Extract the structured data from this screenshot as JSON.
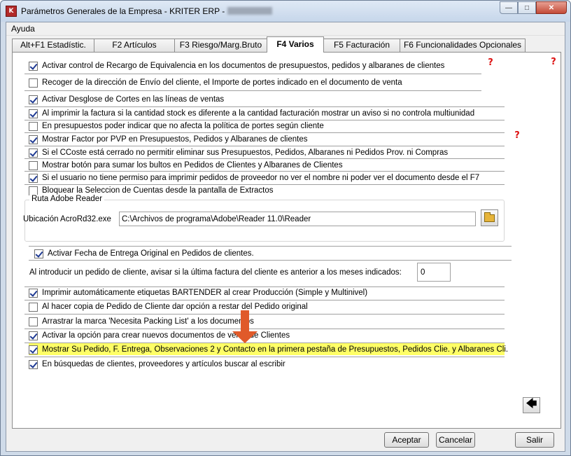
{
  "window": {
    "title": "Parámetros Generales de la Empresa - KRITER ERP -",
    "icon": "app-icon",
    "controls": [
      "minimize-icon",
      "maximize-icon",
      "close-icon"
    ]
  },
  "menu": {
    "items": [
      "Ayuda"
    ]
  },
  "tabs": [
    {
      "label": "Alt+F1 Estadístic.",
      "active": false
    },
    {
      "label": "F2 Artículos",
      "active": false
    },
    {
      "label": "F3 Riesgo/Marg.Bruto",
      "active": false
    },
    {
      "label": "F4 Varios",
      "active": true
    },
    {
      "label": "F5 Facturación",
      "active": false
    },
    {
      "label": "F6 Funcionalidades Opcionales",
      "active": false
    }
  ],
  "options_top": [
    {
      "label": "Activar control de Recargo de Equivalencia en los documentos de presupuestos, pedidos y albaranes de clientes",
      "checked": true
    },
    {
      "label": "Recoger de la dirección de Envío del cliente, el Importe de portes indicado en el documento de venta",
      "checked": false
    },
    {
      "label": "Activar Desglose de Cortes en las líneas de ventas",
      "checked": true
    },
    {
      "label": "Al imprimir la factura si la cantidad stock es diferente a la cantidad facturación mostrar un aviso si no controla multiunidad",
      "checked": true
    },
    {
      "label": "En presupuestos poder indicar que no afecta la política de portes según cliente",
      "checked": false
    },
    {
      "label": "Mostrar Factor por PVP en Presupuestos, Pedidos y Albaranes de clientes",
      "checked": true
    },
    {
      "label": "Si el CCoste está cerrado no permitir eliminar sus Presupuestos, Pedidos, Albaranes ni Pedidos Prov. ni Compras",
      "checked": true
    },
    {
      "label": "Mostrar botón para sumar los bultos en Pedidos de Clientes y Albaranes de Clientes",
      "checked": false
    },
    {
      "label": "Si el usuario no tiene permiso para imprimir pedidos de proveedor no ver el nombre ni poder ver el documento desde el F7",
      "checked": true
    },
    {
      "label": "Bloquear la Seleccion de Cuentas desde la pantalla de Extractos",
      "checked": false
    }
  ],
  "adobe": {
    "group_title": "Ruta Adobe Reader",
    "label": "Ubicación AcroRd32.exe",
    "path": "C:\\Archivos de programa\\Adobe\\Reader 11.0\\Reader"
  },
  "fecha_entrega": {
    "label": "Activar Fecha de Entrega Original en Pedidos de clientes.",
    "checked": true
  },
  "months": {
    "label": "Al introducir un pedido de cliente, avisar si la última factura del cliente es anterior a los meses indicados:",
    "value": "0"
  },
  "options_bottom": [
    {
      "label": "Imprimir automáticamente etiquetas BARTENDER al crear Producción (Simple y Multinivel)",
      "checked": true
    },
    {
      "label": "Al hacer copia de Pedido de Cliente dar opción a restar del Pedido original",
      "checked": false
    },
    {
      "label": "Arrastrar la marca 'Necesita Packing List' a los documentos",
      "checked": false
    },
    {
      "label": "Activar la opción para crear nuevos documentos de venta de Clientes",
      "checked": true
    },
    {
      "label": "Mostrar Su Pedido, F. Entrega, Observaciones 2 y Contacto en la primera pestaña de Presupuestos, Pedidos Clie. y Albaranes Cli.",
      "checked": true,
      "highlighted": true
    },
    {
      "label": "En búsquedas de clientes, proveedores y artículos buscar al escribir",
      "checked": true
    }
  ],
  "help_icon_glyph": "?",
  "back_glyph": "🡄",
  "buttons": {
    "accept": "Aceptar",
    "cancel": "Cancelar",
    "exit": "Salir"
  },
  "colors": {
    "highlight": "#ffff66",
    "annotation_arrow": "#e05a2a",
    "help_icon": "#dd1111"
  }
}
